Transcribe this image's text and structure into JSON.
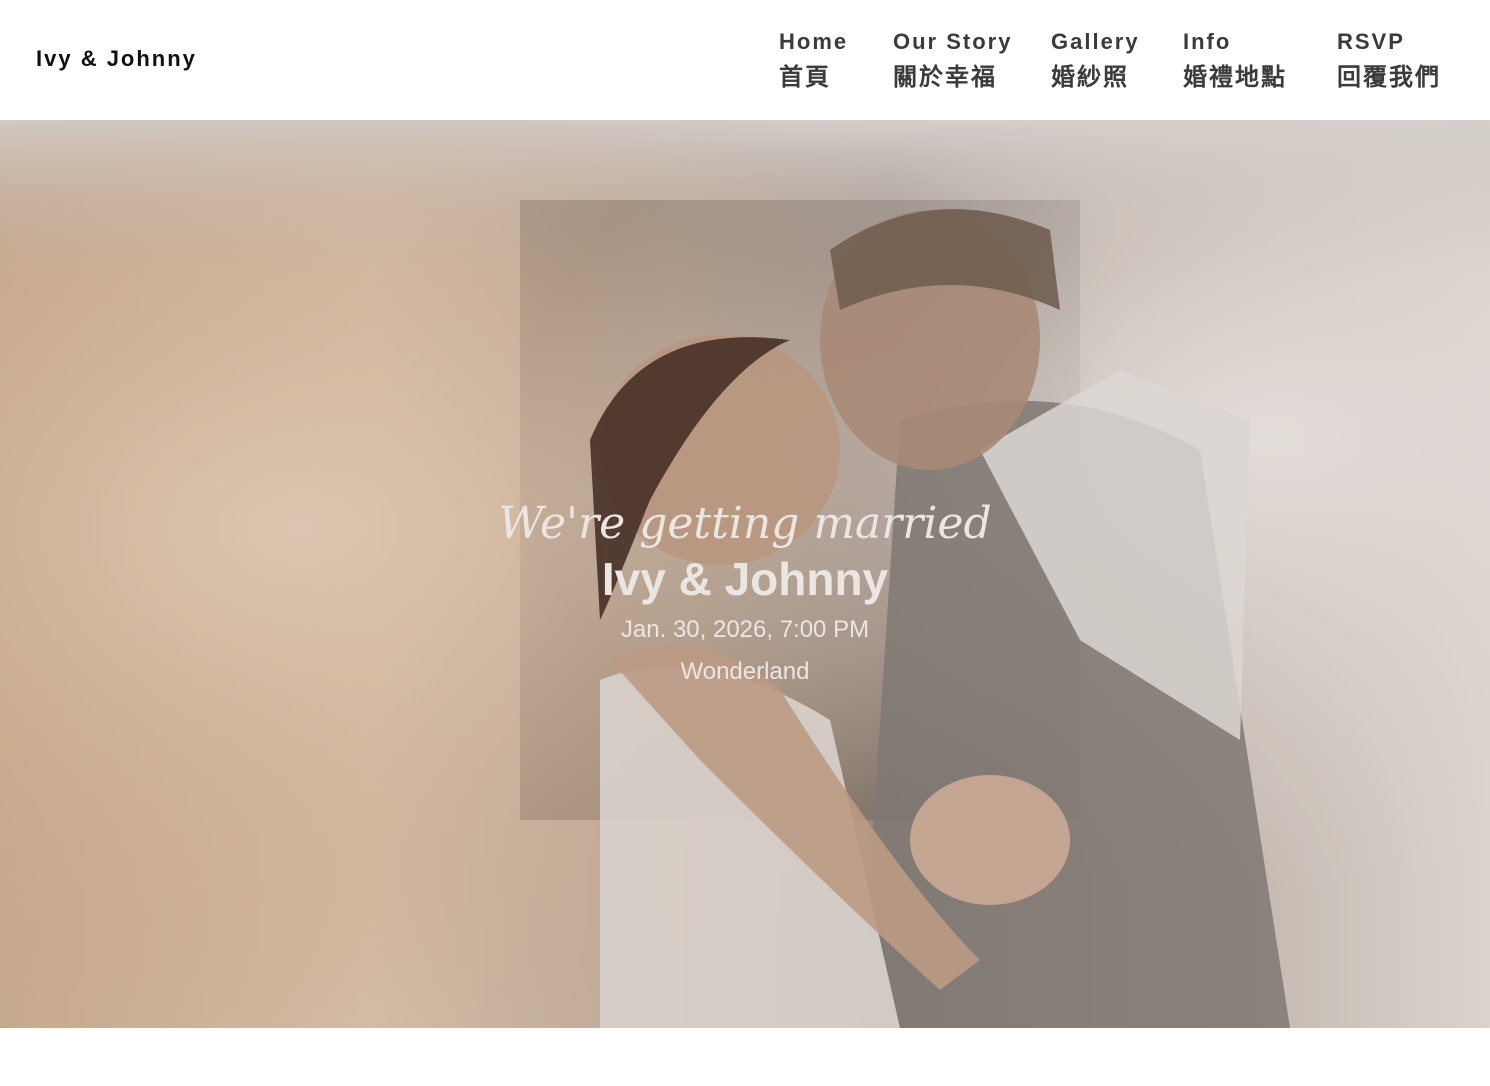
{
  "header": {
    "brand": "Ivy & Johnny",
    "nav": [
      {
        "en": "Home",
        "zh": "首頁"
      },
      {
        "en": "Our Story",
        "zh": "關於幸福"
      },
      {
        "en": "Gallery",
        "zh": "婚紗照"
      },
      {
        "en": "Info",
        "zh": "婚禮地點"
      },
      {
        "en": "RSVP",
        "zh": "回覆我們"
      }
    ]
  },
  "hero": {
    "tagline": "We're getting married",
    "couple": "Ivy & Johnny",
    "date": "Jan. 30, 2026, 7:00 PM",
    "venue": "Wonderland"
  },
  "colors": {
    "header_bg": "#ffffff",
    "nav_text": "#3b3b3b",
    "brand_text": "#111111",
    "hero_text": "#ece6e2"
  }
}
